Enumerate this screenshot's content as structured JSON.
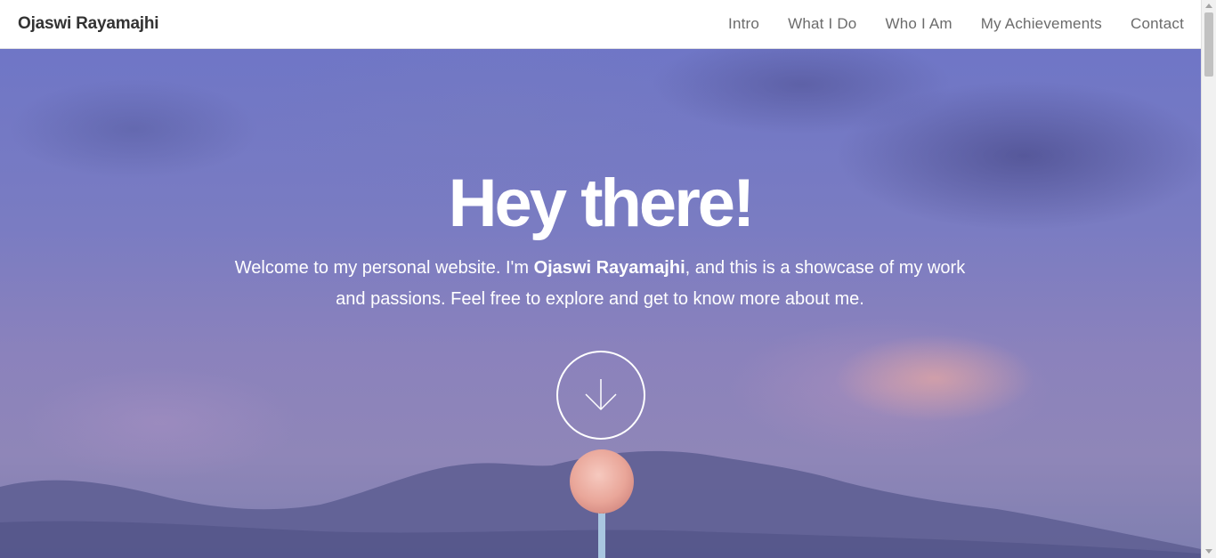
{
  "header": {
    "site_title": "Ojaswi Rayamajhi",
    "nav": [
      {
        "label": "Intro"
      },
      {
        "label": "What I Do"
      },
      {
        "label": "Who I Am"
      },
      {
        "label": "My Achievements"
      },
      {
        "label": "Contact"
      }
    ]
  },
  "hero": {
    "title": "Hey there!",
    "text_before": "Welcome to my personal website. I'm ",
    "name": "Ojaswi Rayamajhi",
    "text_after": ", and this is a showcase of my work and passions. Feel free to explore and get to know more about me.",
    "scroll_icon": "arrow-down-icon"
  },
  "colors": {
    "header_bg": "#ffffff",
    "title_text": "#333333",
    "nav_text": "#6b6b6b",
    "hero_sky": "#7a7cc2",
    "hero_text": "#ffffff"
  }
}
